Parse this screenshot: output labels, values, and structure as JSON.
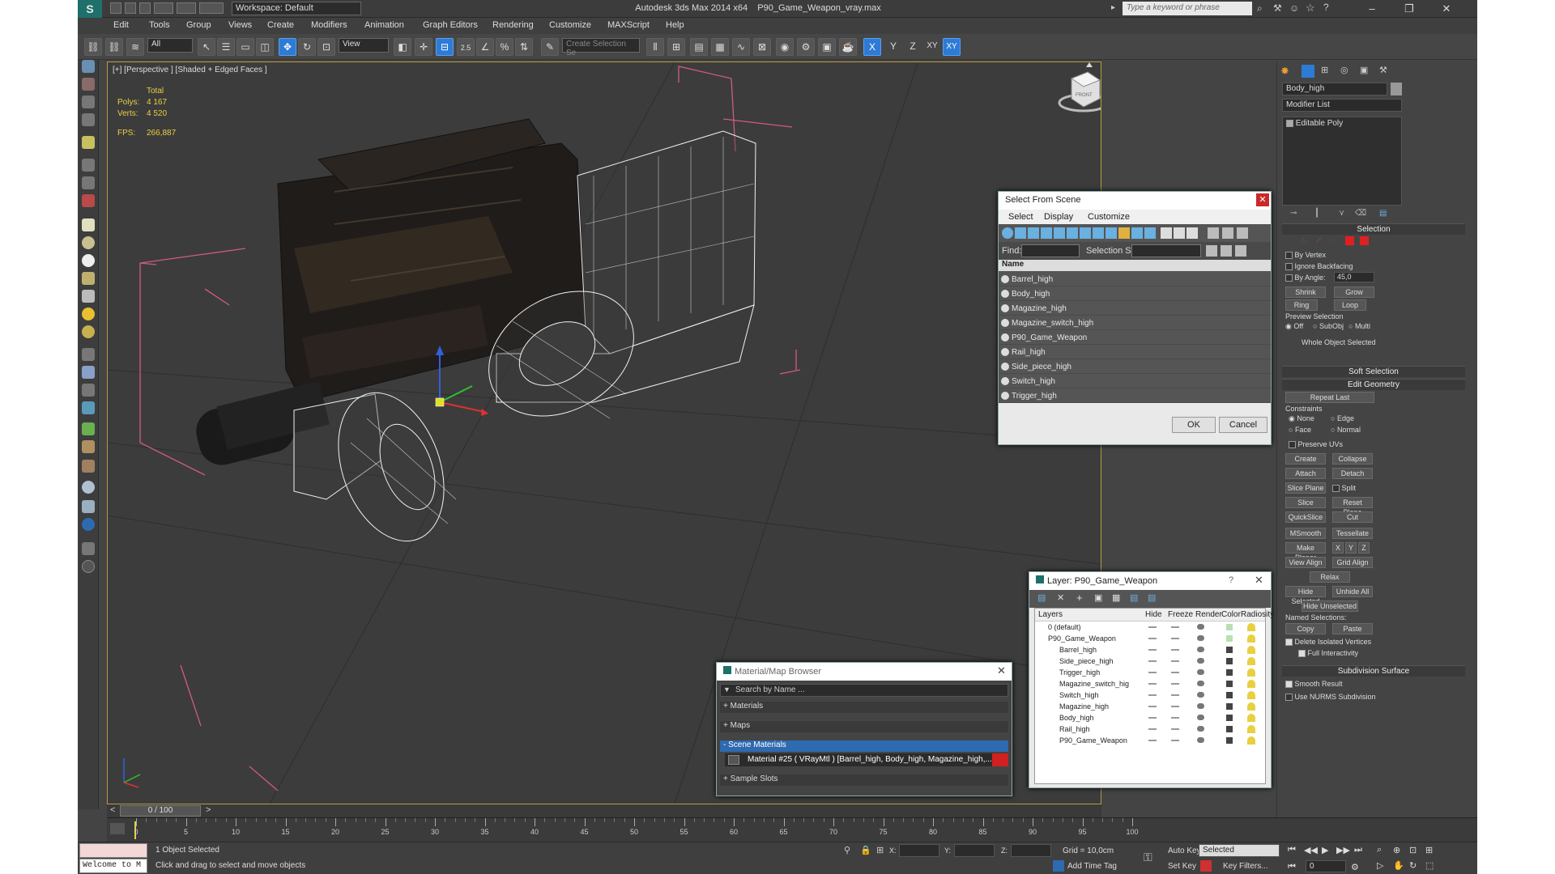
{
  "title_bar": {
    "workspace": "Workspace: Default",
    "app_title": "Autodesk 3ds Max  2014 x64",
    "file_name": "P90_Game_Weapon_vray.max",
    "search_placeholder": "Type a keyword or phrase"
  },
  "menu": [
    "Edit",
    "Tools",
    "Group",
    "Views",
    "Create",
    "Modifiers",
    "Animation",
    "Graph Editors",
    "Rendering",
    "Customize",
    "MAXScript",
    "Help"
  ],
  "toolbar": {
    "selection_filter": "All",
    "ref_coord": "View",
    "named_selection_placeholder": "Create Selection Se",
    "snap_label": "2.5",
    "angle_snap_label": "%",
    "axis_x": "X",
    "axis_y": "Y",
    "axis_z": "Z",
    "axis_xy": "XY",
    "axis_xy2": "XY"
  },
  "viewport": {
    "label": "[+] [Perspective ] [Shaded + Edged Faces ]",
    "stats_total": "Total",
    "polys_label": "Polys:",
    "polys_value": "4 167",
    "verts_label": "Verts:",
    "verts_value": "4 520",
    "fps_label": "FPS:",
    "fps_value": "266,887",
    "viewcube_label": "FRONT"
  },
  "select_from_scene": {
    "title": "Select From Scene",
    "menus": [
      "Select",
      "Display",
      "Customize"
    ],
    "find_label": "Find:",
    "selection_set_label": "Selection Set:",
    "column_name": "Name",
    "items": [
      "Barrel_high",
      "Body_high",
      "Magazine_high",
      "Magazine_switch_high",
      "P90_Game_Weapon",
      "Rail_high",
      "Side_piece_high",
      "Switch_high",
      "Trigger_high"
    ],
    "ok": "OK",
    "cancel": "Cancel"
  },
  "layer_dialog": {
    "title": "Layer: P90_Game_Weapon",
    "help": "?",
    "columns": [
      "Layers",
      "Hide",
      "Freeze",
      "Render",
      "Color",
      "Radiosity"
    ],
    "rows": [
      "0 (default)",
      "P90_Game_Weapon",
      "Barrel_high",
      "Side_piece_high",
      "Trigger_high",
      "Magazine_switch_hig",
      "Switch_high",
      "Magazine_high",
      "Body_high",
      "Rail_high",
      "P90_Game_Weapon"
    ]
  },
  "material_browser": {
    "title": "Material/Map Browser",
    "search_placeholder": "Search by Name ...",
    "sections": [
      "+ Materials",
      "+ Maps",
      "- Scene Materials",
      "+ Sample Slots"
    ],
    "material_entry": "Material #25  ( VRayMtl )  [Barrel_high, Body_high, Magazine_high,..."
  },
  "command_panel": {
    "object_name": "Body_high",
    "modifier_list": "Modifier List",
    "stack_item": "Editable Poly",
    "selection": {
      "header": "Selection",
      "by_vertex": "By Vertex",
      "ignore_backfacing": "Ignore Backfacing",
      "by_angle": "By Angle:",
      "angle_value": "45,0",
      "shrink": "Shrink",
      "grow": "Grow",
      "ring": "Ring",
      "loop": "Loop",
      "preview_selection": "Preview Selection",
      "off": "Off",
      "subobj": "SubObj",
      "multi": "Multi",
      "whole_object": "Whole Object Selected"
    },
    "soft_selection": "Soft Selection",
    "edit_geometry": {
      "header": "Edit Geometry",
      "repeat_last": "Repeat Last",
      "constraints": "Constraints",
      "none": "None",
      "edge": "Edge",
      "face": "Face",
      "normal": "Normal",
      "preserve_uvs": "Preserve UVs",
      "create": "Create",
      "collapse": "Collapse",
      "attach": "Attach",
      "detach": "Detach",
      "slice_plane": "Slice Plane",
      "split": "Split",
      "slice": "Slice",
      "reset_plane": "Reset Plane",
      "quickslice": "QuickSlice",
      "cut": "Cut",
      "msmooth": "MSmooth",
      "tessellate": "Tessellate",
      "make_planar": "Make Planar",
      "x": "X",
      "y": "Y",
      "z": "Z",
      "view_align": "View Align",
      "grid_align": "Grid Align",
      "relax": "Relax",
      "hide_selected": "Hide Selected",
      "unhide_all": "Unhide All",
      "hide_unselected": "Hide Unselected",
      "named_selections": "Named Selections:",
      "copy": "Copy",
      "paste": "Paste",
      "delete_isolated": "Delete Isolated Vertices",
      "full_interactivity": "Full Interactivity"
    },
    "subdivision": {
      "header": "Subdivision Surface",
      "smooth_result": "Smooth Result",
      "use_nurms": "Use NURMS Subdivision"
    }
  },
  "timeline": {
    "frame_display": "0 / 100",
    "ticks": [
      "0",
      "5",
      "10",
      "15",
      "20",
      "25",
      "30",
      "35",
      "40",
      "45",
      "50",
      "55",
      "60",
      "65",
      "70",
      "75",
      "80",
      "85",
      "90",
      "95",
      "100"
    ]
  },
  "status": {
    "maxscript": "Welcome to M",
    "selected_count": "1 Object Selected",
    "prompt": "Click and drag to select and move objects",
    "x_label": "X:",
    "y_label": "Y:",
    "z_label": "Z:",
    "grid": "Grid = 10,0cm",
    "add_time_tag": "Add Time Tag",
    "auto_key": "Auto Key",
    "set_key": "Set Key",
    "key_mode": "Selected",
    "key_filters": "Key Filters...",
    "current_frame": "0"
  }
}
